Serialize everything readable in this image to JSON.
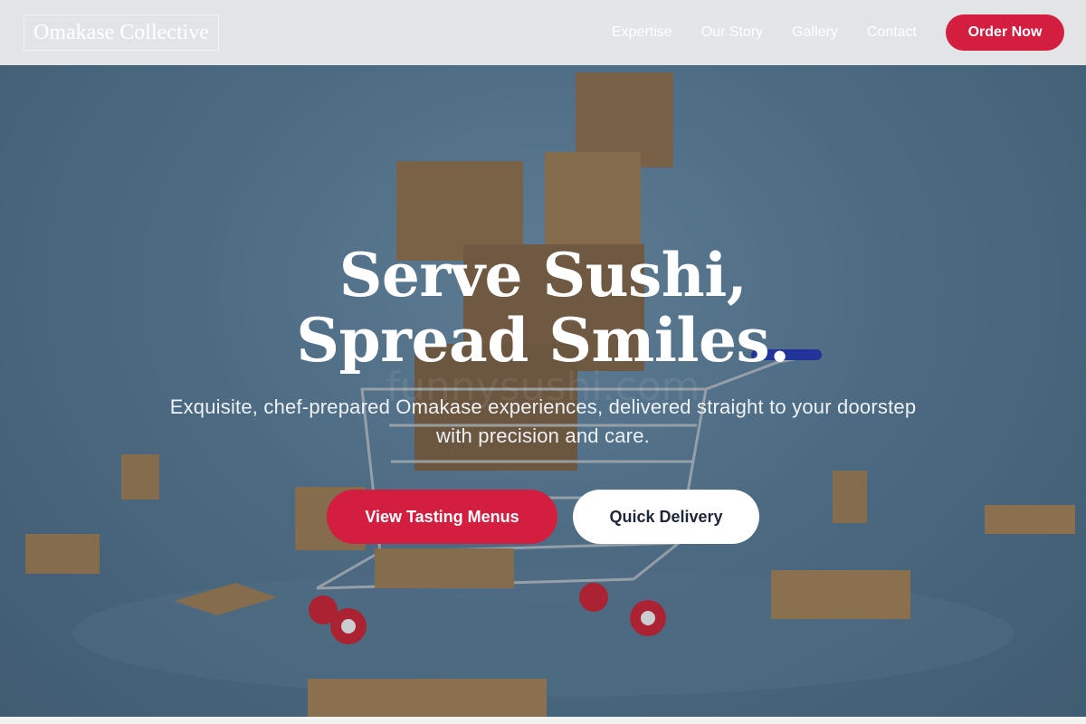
{
  "navbar": {
    "brand": "Omakase Collective",
    "links": [
      "Expertise",
      "Our Story",
      "Gallery",
      "Contact"
    ],
    "order_button": "Order Now"
  },
  "hero": {
    "title": "Serve Sushi, Spread Smiles.",
    "subtitle": "Exquisite, chef-prepared Omakase experiences, delivered straight to your doorstep with precision and care.",
    "primary_cta": "View Tasting Menus",
    "secondary_cta": "Quick Delivery",
    "watermark": "funnysushi.com"
  },
  "colors": {
    "accent": "#d31e3f",
    "navbar_bg": "#f0f0f0",
    "hero_bg": "#4e6d85",
    "secondary_cta_text": "#1d2738"
  },
  "icons": {
    "background_image": "shopping-cart-with-parcels-image"
  }
}
